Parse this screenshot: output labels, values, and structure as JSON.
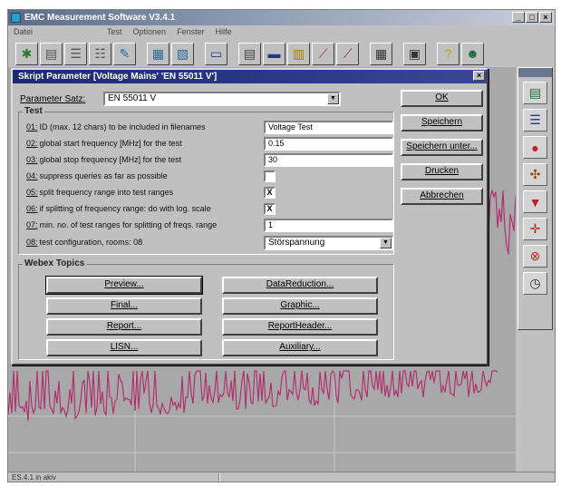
{
  "app": {
    "title": "EMC Measurement Software V3.4.1",
    "window_buttons": [
      "_",
      "□",
      "×"
    ]
  },
  "menu": [
    "Datei",
    "Test",
    "Optionen",
    "Fenster",
    "Hilfe"
  ],
  "toolbar": {
    "icons": [
      "tools-icon",
      "document-icon",
      "list-icon",
      "list-icon",
      "wand-icon",
      "chart-icon",
      "chart-icon",
      "monitor-icon",
      "chart-icon",
      "chart-icon",
      "chart-icon",
      "chart-icon",
      "chart-icon",
      "chart-icon",
      "help-icon",
      "user-icon"
    ]
  },
  "dialog": {
    "title": "Skript Parameter [Voltage Mains' 'EN 55011 V']",
    "parameter_set_label": "Parameter Satz:",
    "parameter_set_value": "EN 55011 V",
    "test_group_title": "Test",
    "fields": [
      {
        "num": "01:",
        "label": "ID (max. 12 chars) to be included in filenames",
        "value": "Voltage Test"
      },
      {
        "num": "02:",
        "label": "global start frequency [MHz] for the test",
        "value": "0.15"
      },
      {
        "num": "03:",
        "label": "global stop frequency [MHz] for the test",
        "value": "30"
      },
      {
        "num": "04:",
        "label": "suppress queries as far as possible",
        "value": ""
      },
      {
        "num": "05:",
        "label": "split frequency range into test ranges",
        "value": "X"
      },
      {
        "num": "06:",
        "label": "if splitting of frequency range: do with log. scale",
        "value": "X"
      },
      {
        "num": "07:",
        "label": "min. no. of test ranges for splitting of freqs. range",
        "value": "1"
      },
      {
        "num": "08:",
        "label": "test configuration, rooms: 08",
        "value": "Störspannung"
      }
    ],
    "webex_group_title": "Webex Topics",
    "webex_buttons_left": [
      "Preview...",
      "Final...",
      "Report...",
      "LISN..."
    ],
    "webex_buttons_right": [
      "DataReduction...",
      "Graphic...",
      "ReportHeader...",
      "Auxiliary..."
    ],
    "side_buttons": [
      "OK",
      "Speichern",
      "Speichern unter...",
      "Drucken",
      "Abbrechen"
    ]
  },
  "right_panel": {
    "icons": [
      "report-icon",
      "list-icon",
      "lip-icon",
      "settings-icon",
      "cart-icon",
      "target-icon",
      "stop-icon",
      "clock-icon"
    ]
  },
  "status": {
    "text": "ES.4.1 in akiv"
  },
  "colors": {
    "graph_line": "#b0336f",
    "dialog_title": "#1c2a6e",
    "face": "#c0c0c0"
  }
}
